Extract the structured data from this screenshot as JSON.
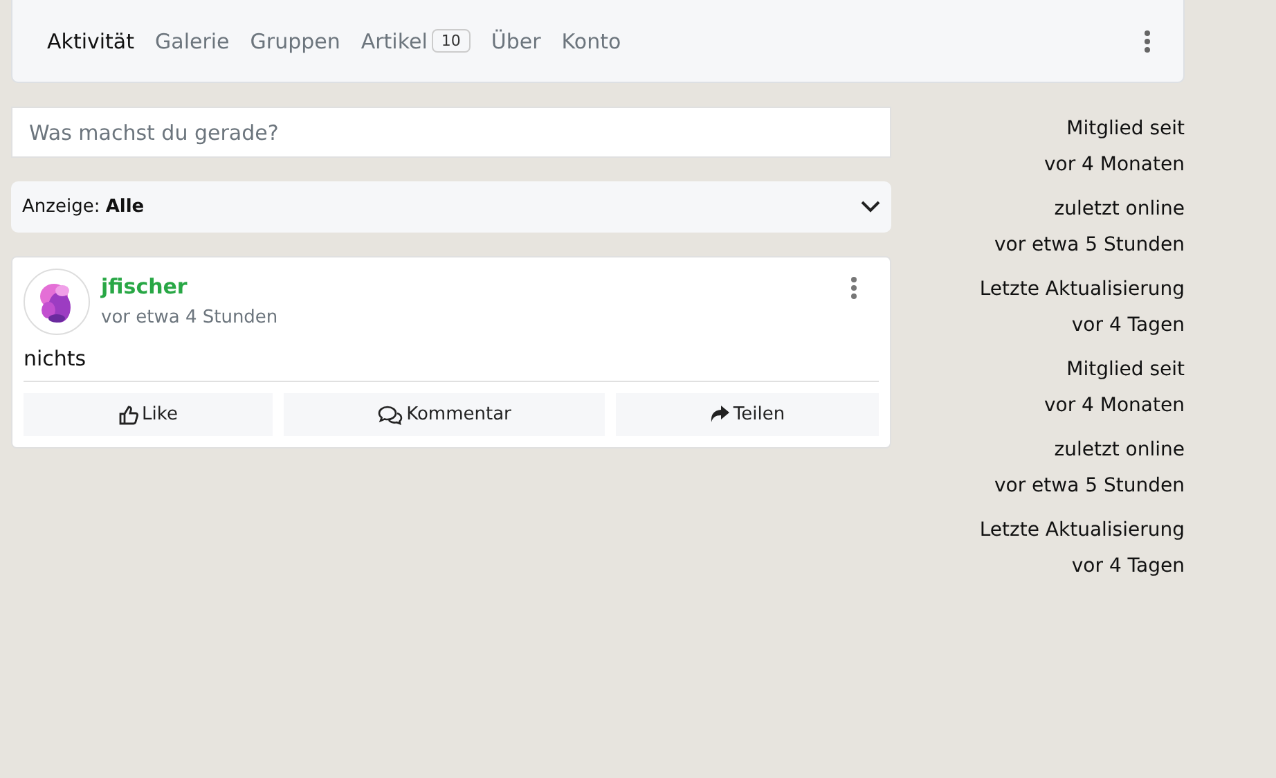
{
  "tabs": [
    {
      "label": "Aktivität",
      "selected": true
    },
    {
      "label": "Galerie",
      "selected": false
    },
    {
      "label": "Gruppen",
      "selected": false
    },
    {
      "label": "Artikel",
      "selected": false,
      "badge": "10"
    },
    {
      "label": "Über",
      "selected": false
    },
    {
      "label": "Konto",
      "selected": false
    }
  ],
  "composer": {
    "placeholder": "Was machst du gerade?"
  },
  "filter": {
    "label": "Anzeige: **Alle**"
  },
  "post": {
    "author": "jfischer",
    "time": "vor etwa 4 Stunden",
    "text": "nichts",
    "actions": [
      {
        "kind": "like",
        "label": "Like"
      },
      {
        "kind": "comment",
        "label": "Kommentar"
      },
      {
        "kind": "share",
        "label": "Teilen"
      }
    ]
  },
  "info": [
    {
      "label": "Mitglied seit",
      "value": "vor 4 Monaten"
    },
    {
      "label": "zuletzt online",
      "value": "vor etwa 5 Stunden"
    },
    {
      "label": "Letzte Aktualisierung",
      "value": "vor 4 Tagen"
    },
    {
      "label": "Mitglied seit",
      "value": "vor 4 Monaten"
    },
    {
      "label": "zuletzt online",
      "value": "vor etwa 5 Stunden"
    },
    {
      "label": "Letzte Aktualisierung",
      "value": "vor 4 Tagen"
    }
  ]
}
